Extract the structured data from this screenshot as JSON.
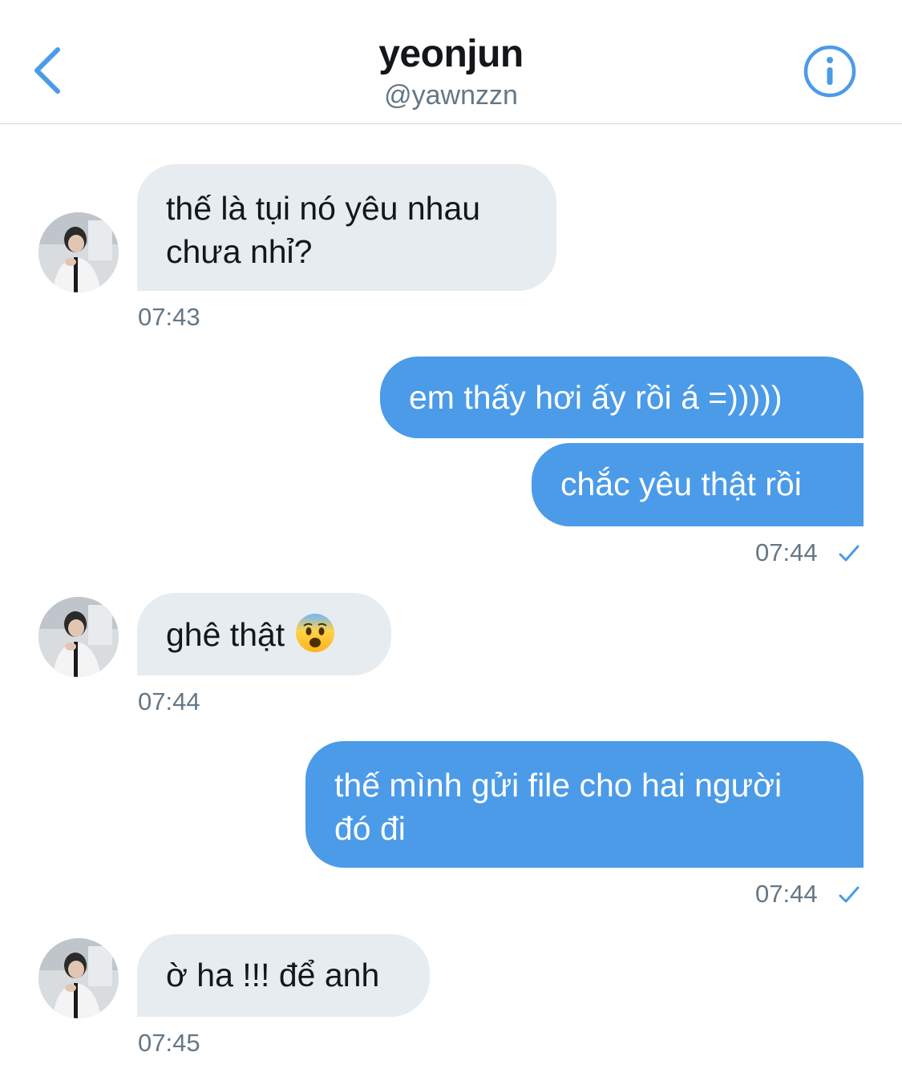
{
  "header": {
    "title": "yeonjun",
    "handle": "@yawnzzn",
    "back_icon": "chevron-left-icon",
    "info_icon": "info-circle-icon",
    "accent_color": "#4b9be8"
  },
  "messages": [
    {
      "direction": "incoming",
      "text_line1": "thế là tụi nó yêu nhau",
      "text_line2": "chưa nhỉ?",
      "time": "07:43"
    },
    {
      "direction": "outgoing",
      "text": "em thấy hơi ấy rồi á =)))))"
    },
    {
      "direction": "outgoing",
      "text": "chắc yêu thật rồi",
      "time": "07:44",
      "status_icon": "checkmark-icon"
    },
    {
      "direction": "incoming",
      "text": "ghê thật",
      "emoji": "anxious-face-emoji",
      "time": "07:44"
    },
    {
      "direction": "outgoing",
      "text_line1": "thế mình gửi file cho hai người",
      "text_line2": "đó đi",
      "time": "07:44",
      "status_icon": "checkmark-icon"
    },
    {
      "direction": "incoming",
      "text": "ờ ha !!! để anh",
      "time": "07:45"
    }
  ],
  "colors": {
    "incoming_bubble": "#e6ecf0",
    "outgoing_bubble": "#4b9be8",
    "timestamp": "#657786"
  }
}
